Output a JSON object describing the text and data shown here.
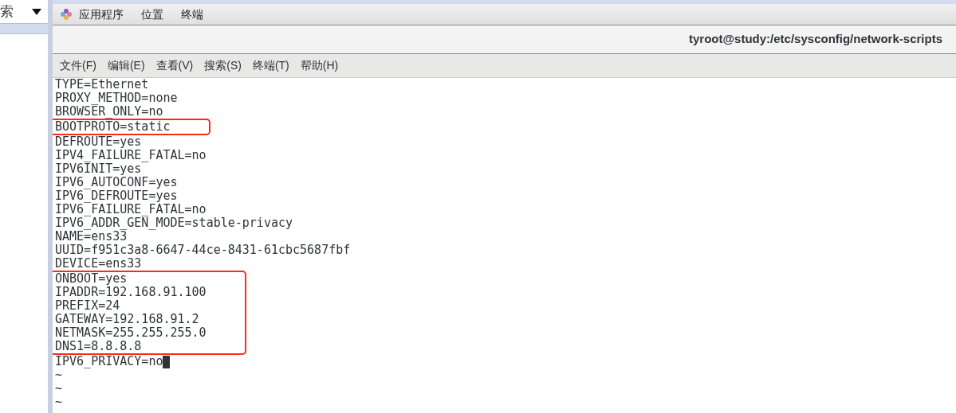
{
  "sidebar": {
    "search_field": {
      "value": "索"
    }
  },
  "top_panel": {
    "menus": [
      "应用程序",
      "位置",
      "终端"
    ]
  },
  "window": {
    "title": "tyroot@study:/etc/sysconfig/network-scripts"
  },
  "menu_bar": [
    "文件(F)",
    "编辑(E)",
    "查看(V)",
    "搜索(S)",
    "终端(T)",
    "帮助(H)"
  ],
  "blocks": [
    {
      "highlighted": false,
      "lines": [
        {
          "text": "TYPE=Ethernet",
          "cursor": false
        },
        {
          "text": "PROXY_METHOD=none",
          "cursor": false
        },
        {
          "text": "BROWSER_ONLY=no",
          "cursor": false
        }
      ]
    },
    {
      "highlighted": true,
      "lines": [
        {
          "text": "BOOTPROTO=static",
          "cursor": false
        }
      ]
    },
    {
      "highlighted": false,
      "lines": [
        {
          "text": "DEFROUTE=yes",
          "cursor": false
        },
        {
          "text": "IPV4_FAILURE_FATAL=no",
          "cursor": false
        },
        {
          "text": "IPV6INIT=yes",
          "cursor": false
        },
        {
          "text": "IPV6_AUTOCONF=yes",
          "cursor": false
        },
        {
          "text": "IPV6_DEFROUTE=yes",
          "cursor": false
        },
        {
          "text": "IPV6_FAILURE_FATAL=no",
          "cursor": false
        },
        {
          "text": "IPV6_ADDR_GEN_MODE=stable-privacy",
          "cursor": false
        },
        {
          "text": "NAME=ens33",
          "cursor": false
        },
        {
          "text": "UUID=f951c3a8-6647-44ce-8431-61cbc5687fbf",
          "cursor": false
        },
        {
          "text": "DEVICE=ens33",
          "cursor": false
        }
      ]
    },
    {
      "highlighted": true,
      "lines": [
        {
          "text": "ONBOOT=yes",
          "cursor": false
        },
        {
          "text": "IPADDR=192.168.91.100",
          "cursor": false
        },
        {
          "text": "PREFIX=24",
          "cursor": false
        },
        {
          "text": "GATEWAY=192.168.91.2",
          "cursor": false
        },
        {
          "text": "NETMASK=255.255.255.0",
          "cursor": false
        },
        {
          "text": "DNS1=8.8.8.8",
          "cursor": false
        }
      ]
    },
    {
      "highlighted": false,
      "lines": [
        {
          "text": "IPV6_PRIVACY=no",
          "cursor": true
        },
        {
          "text": "~",
          "cursor": false
        },
        {
          "text": "~",
          "cursor": false
        },
        {
          "text": "~",
          "cursor": false
        }
      ]
    }
  ]
}
